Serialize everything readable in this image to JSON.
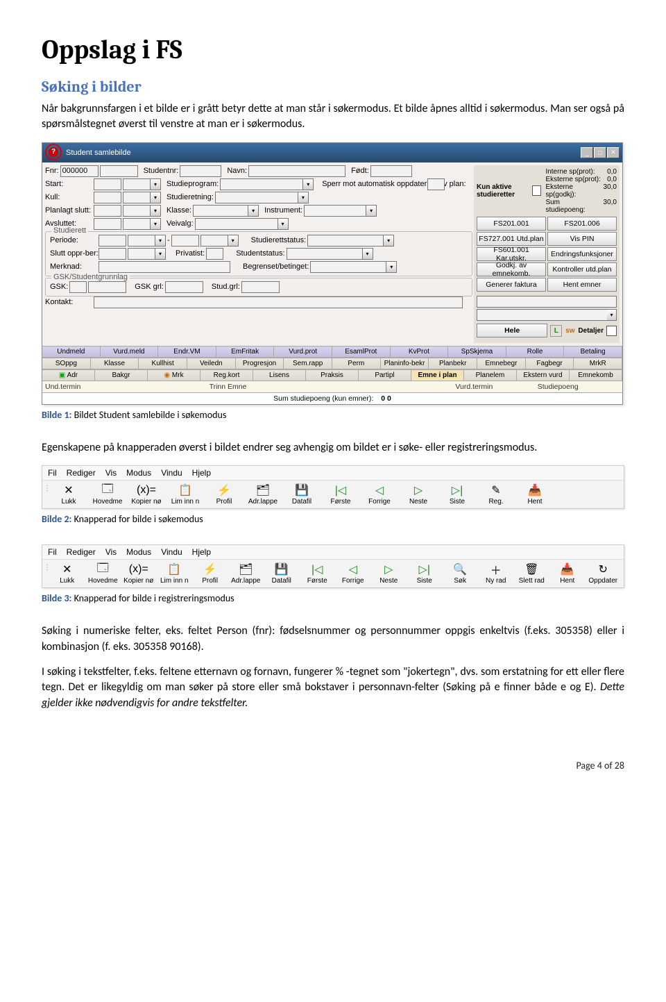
{
  "heading": "Oppslag i FS",
  "subheading": "Søking i bilder",
  "para1": "Når bakgrunnsfargen i et bilde er i grått betyr dette at man står i søkermodus. Et bilde åpnes alltid i søkermodus. Man ser også på spørsmålstegnet øverst til venstre at man er i søkermodus.",
  "caption1_lead": "Bilde 1:",
  "caption1": " Bildet Student samlebilde i søkemodus",
  "para2": "Egenskapene på knapperaden øverst i bildet endrer seg avhengig om bildet er i søke- eller registreringsmodus.",
  "caption2_lead": "Bilde 2:",
  "caption2": " Knapperad for bilde i søkemodus",
  "caption3_lead": "Bilde 3:",
  "caption3": " Knapperad for bilde i registreringsmodus",
  "para3": "Søking i numeriske felter, eks. feltet Person (fnr): fødselsnummer og personnummer oppgis enkeltvis (f.eks. 305358) eller i kombinasjon (f. eks. 305358 90168).",
  "para4a": "I søking i tekstfelter, f.eks. feltene etternavn og fornavn, fungerer % -tegnet som \"jokertegn\", dvs. som erstatning for ett eller flere tegn. Det er likegyldig om man søker på store eller små bokstaver i personnavn-felter (Søking på e finner både e og E). ",
  "para4b": "Dette gjelder ikke nødvendigvis for andre tekstfelter.",
  "footer": "Page 4 of 28",
  "shot1": {
    "title": "Student samlebilde",
    "fields": {
      "fnr_lbl": "Fnr:",
      "fnr_val": "000000",
      "studentnr_lbl": "Studentnr:",
      "navn_lbl": "Navn:",
      "fodt_lbl": "Født:",
      "start_lbl": "Start:",
      "studieprogram_lbl": "Studieprogram:",
      "sperr_lbl": "Sperr mot automatisk oppdatering av plan:",
      "kull_lbl": "Kull:",
      "studieretning_lbl": "Studieretning:",
      "planlagt_lbl": "Planlagt slutt:",
      "klasse_lbl": "Klasse:",
      "instrument_lbl": "Instrument:",
      "avsluttet_lbl": "Avsluttet:",
      "veivalg_lbl": "Veivalg:",
      "studierett_grp": "Studierett",
      "periode_lbl": "Periode:",
      "studierettstatus_lbl": "Studierettstatus:",
      "slutt_opprber_lbl": "Slutt oppr-ber:",
      "privatist_lbl": "Privatist:",
      "studentstatus_lbl": "Studentstatus:",
      "merknad_lbl": "Merknad:",
      "begrenset_lbl": "Begrenset/betinget:",
      "gsk_grp": "GSK/Studentgrunnlag",
      "gsk_lbl": "GSK:",
      "gskgrl_lbl": "GSK grl:",
      "studgrl_lbl": "Stud.grl:",
      "kontakt_lbl": "Kontakt:"
    },
    "right": {
      "kun_aktive": "Kun aktive studieretter",
      "stats_lines": [
        "Interne sp(prot):",
        "Eksterne sp(prot):",
        "Eksterne sp(godkj):",
        "Sum studiepoeng:"
      ],
      "stats_vals": [
        "0,0",
        "0,0",
        "30,0",
        "30,0"
      ],
      "btns": [
        "FS201.001",
        "FS201.006",
        "FS727.001 Utd.plan",
        "Vis PIN",
        "FS601.001 Kar.utskr.",
        "Endringsfunksjoner",
        "Godkj. av emnekomb.",
        "Kontroller utd.plan",
        "Generer faktura",
        "Hent emner"
      ],
      "hele": "Hele",
      "L_icon": "L",
      "sw_icon": "sw",
      "detaljer": "Detaljer"
    },
    "tabs1": [
      "Undmeld",
      "Vurd.meld",
      "Endr.VM",
      "EmFritak",
      "Vurd.prot",
      "EsamlProt",
      "KvProt",
      "SpSkjema",
      "Rolle",
      "Betaling"
    ],
    "tabs2": [
      "SOppg",
      "Klasse",
      "Kullhist",
      "Veiledn",
      "Progresjon",
      "Sem.rapp",
      "Perm",
      "Planinfo-bekr",
      "Planbekr",
      "Emnebegr",
      "Fagbegr",
      "MrkR"
    ],
    "tabs3": [
      "Adr",
      "Bakgr",
      "Mrk",
      "Reg.kort",
      "Lisens",
      "Praksis",
      "Partipl",
      "Emne i plan",
      "Planelem",
      "Ekstern vurd",
      "Emnekomb"
    ],
    "yellow_row": [
      "Und.termin",
      "",
      "Trinn Emne",
      "",
      "",
      "Vurd.termin",
      "Studiepoeng"
    ],
    "status": "Sum studiepoeng (kun emner):",
    "status_val": "0  0"
  },
  "menubar": [
    "Fil",
    "Rediger",
    "Vis",
    "Modus",
    "Vindu",
    "Hjelp"
  ],
  "toolbar_search": [
    {
      "icon": "✕",
      "lbl": "Lukk"
    },
    {
      "icon": "🗔",
      "lbl": "Hovedme"
    },
    {
      "icon": "(x)=",
      "lbl": "Kopier nø"
    },
    {
      "icon": "📋",
      "lbl": "Lim inn n"
    },
    {
      "icon": "⚡",
      "lbl": "Profil"
    },
    {
      "icon": "🗂",
      "lbl": "Adr.lappe"
    },
    {
      "icon": "💾",
      "lbl": "Datafil"
    },
    {
      "icon": "|◁",
      "lbl": "Første",
      "c": "#228822"
    },
    {
      "icon": "◁",
      "lbl": "Forrige",
      "c": "#228822"
    },
    {
      "icon": "▷",
      "lbl": "Neste",
      "c": "#228822"
    },
    {
      "icon": "▷|",
      "lbl": "Siste",
      "c": "#228822"
    },
    {
      "icon": "✎",
      "lbl": "Reg."
    },
    {
      "icon": "📥",
      "lbl": "Hent"
    }
  ],
  "toolbar_reg": [
    {
      "icon": "✕",
      "lbl": "Lukk"
    },
    {
      "icon": "🗔",
      "lbl": "Hovedme"
    },
    {
      "icon": "(x)=",
      "lbl": "Kopier nø"
    },
    {
      "icon": "📋",
      "lbl": "Lim inn n"
    },
    {
      "icon": "⚡",
      "lbl": "Profil"
    },
    {
      "icon": "🗂",
      "lbl": "Adr.lappe"
    },
    {
      "icon": "💾",
      "lbl": "Datafil"
    },
    {
      "icon": "|◁",
      "lbl": "Første",
      "c": "#228822"
    },
    {
      "icon": "◁",
      "lbl": "Forrige",
      "c": "#228822"
    },
    {
      "icon": "▷",
      "lbl": "Neste",
      "c": "#228822"
    },
    {
      "icon": "▷|",
      "lbl": "Siste",
      "c": "#228822"
    },
    {
      "icon": "🔍",
      "lbl": "Søk"
    },
    {
      "icon": "＋",
      "lbl": "Ny rad"
    },
    {
      "icon": "🗑",
      "lbl": "Slett rad"
    },
    {
      "icon": "📥",
      "lbl": "Hent"
    },
    {
      "icon": "↻",
      "lbl": "Oppdater"
    }
  ]
}
